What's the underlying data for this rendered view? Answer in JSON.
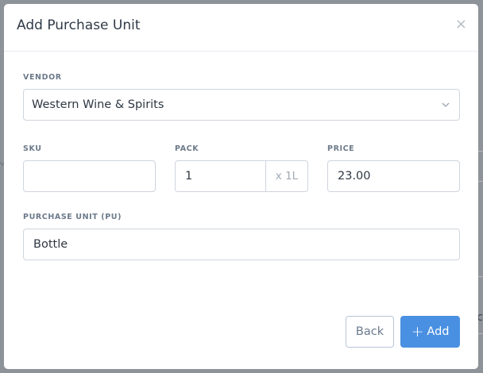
{
  "modal": {
    "title": "Add Purchase Unit",
    "close_icon": "close-icon"
  },
  "vendor": {
    "label": "VENDOR",
    "value": "Western Wine & Spirits"
  },
  "sku": {
    "label": "SKU",
    "value": ""
  },
  "pack": {
    "label": "PACK",
    "value": "1",
    "suffix": "x 1L"
  },
  "price": {
    "label": "PRICE",
    "value": "23.00"
  },
  "purchase_unit": {
    "label": "PURCHASE UNIT (PU)",
    "value": "Bottle"
  },
  "buttons": {
    "back_label": "Back",
    "add_label": "Add",
    "add_icon": "plus-icon"
  },
  "background": {
    "partial_char": "c"
  },
  "colors": {
    "primary": "#4a90e2",
    "overlay": "#8e9299"
  }
}
